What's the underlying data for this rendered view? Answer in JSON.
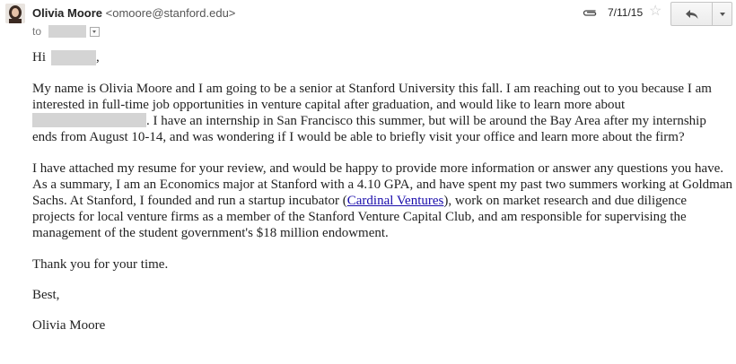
{
  "message": {
    "sender_name": "Olivia Moore",
    "sender_email": "<omoore@stanford.edu>",
    "to_label": "to",
    "date": "7/11/15"
  },
  "body": {
    "greeting": "Hi",
    "greeting_comma": ",",
    "p1_a": "My name is Olivia Moore and I am going to be a senior at Stanford University this fall. I am reaching out to you because I am interested in full-time job opportunities in venture capital after graduation, and would like to learn more about",
    "p1_b": ". I have an internship in San Francisco this summer, but will be around the Bay Area after my internship ends from August 10-14, and was wondering if I would be able to briefly visit your office and learn more about the firm?",
    "p2_a": "I have attached my resume for your review, and would be happy to provide more information or answer any questions you have. As a summary, I am an Economics major at Stanford with a 4.10 GPA, and have spent my past two summers working at Goldman Sachs. At Stanford, I founded and run a startup incubator (",
    "p2_link": "Cardinal Ventures",
    "p2_b": "), work on market research and due diligence projects for local venture firms as a member of the Stanford Venture Capital Club, and am responsible for supervising the management of the student government's $18 million endowment.",
    "thanks": "Thank you for your time.",
    "signoff": "Best,",
    "signature": "Olivia Moore"
  },
  "icons": {
    "attachment": "paperclip-icon",
    "star": "star-outline-icon",
    "reply": "reply-arrow-icon",
    "more": "chevron-down-icon"
  },
  "colors": {
    "link": "#1a0dab",
    "redaction": "#d4d4d4"
  }
}
